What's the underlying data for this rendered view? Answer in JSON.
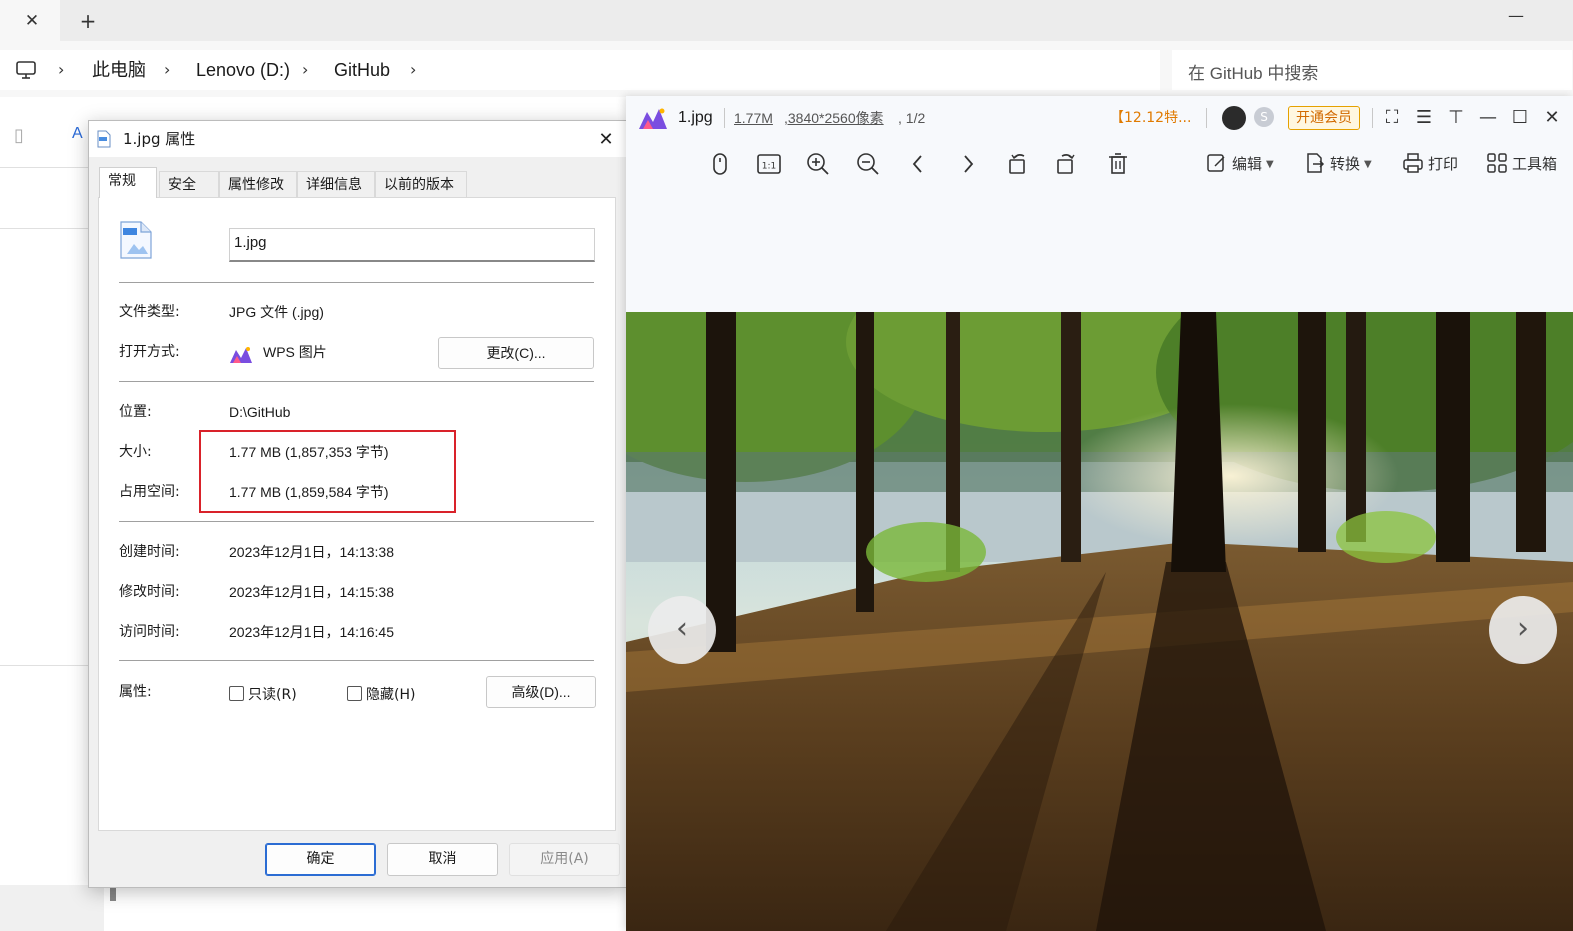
{
  "explorer": {
    "new_tab": "+",
    "close_tab": "✕",
    "breadcrumb": [
      "此电脑",
      "Lenovo (D:)",
      "GitHub"
    ],
    "search_placeholder": "在 GitHub 中搜索"
  },
  "dialog": {
    "title": "1.jpg 属性",
    "tabs": [
      "常规",
      "安全",
      "属性修改",
      "详细信息",
      "以前的版本"
    ],
    "active_tab": "常规",
    "file_name": "1.jpg",
    "rows": {
      "type_label": "文件类型:",
      "type_value": "JPG 文件 (.jpg)",
      "open_label": "打开方式:",
      "open_value": "WPS 图片",
      "change_button": "更改(C)...",
      "location_label": "位置:",
      "location_value": "D:\\GitHub",
      "size_label": "大小:",
      "size_value": "1.77 MB (1,857,353 字节)",
      "disk_label": "占用空间:",
      "disk_value": "1.77 MB (1,859,584 字节)",
      "created_label": "创建时间:",
      "created_value": "2023年12月1日，14:13:38",
      "modified_label": "修改时间:",
      "modified_value": "2023年12月1日，14:15:38",
      "accessed_label": "访问时间:",
      "accessed_value": "2023年12月1日，14:16:45",
      "attr_label": "属性:",
      "readonly_label": "只读(R)",
      "hidden_label": "隐藏(H)",
      "advanced_button": "高级(D)..."
    },
    "buttons": {
      "ok": "确定",
      "cancel": "取消",
      "apply": "应用(A)"
    }
  },
  "viewer": {
    "file_name": "1.jpg",
    "file_size": "1.77M",
    "dimensions": ",3840*2560像素",
    "page_info": ", 1/2",
    "promo": "【12.12特...",
    "vip_button": "开通会员",
    "tools": {
      "edit": "编辑",
      "convert": "转换",
      "print": "打印",
      "toolbox": "工具箱",
      "one_to_one": "1:1"
    },
    "prev": "‹",
    "next": "›"
  },
  "colors": {
    "highlight_border": "#d9222a",
    "vip_orange": "#e07a00",
    "accent_blue": "#2b6cd3"
  }
}
